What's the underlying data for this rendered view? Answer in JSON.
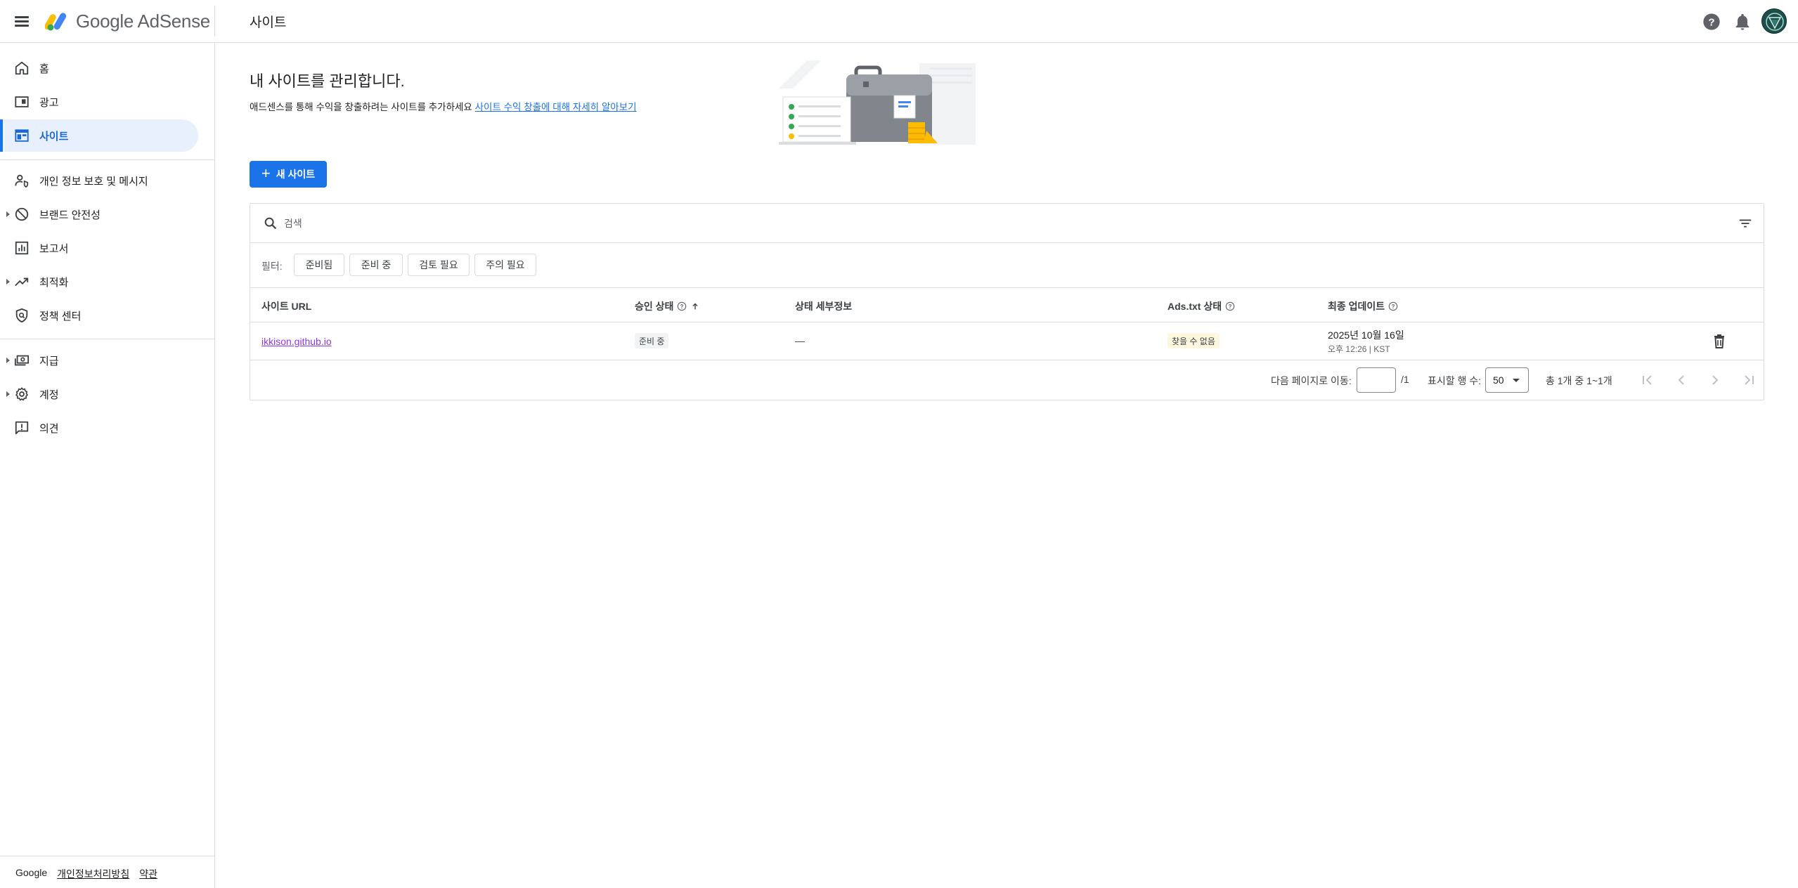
{
  "header": {
    "logo_text": "Google AdSense",
    "page_title": "사이트"
  },
  "sidebar": {
    "items": [
      {
        "label": "홈",
        "icon": "home-icon"
      },
      {
        "label": "광고",
        "icon": "ads-icon"
      },
      {
        "label": "사이트",
        "icon": "sites-icon",
        "active": true
      },
      {
        "label": "개인 정보 보호 및 메시지",
        "icon": "privacy-messaging-icon"
      },
      {
        "label": "브랜드 안전성",
        "icon": "block-icon",
        "expandable": true
      },
      {
        "label": "보고서",
        "icon": "reports-icon"
      },
      {
        "label": "최적화",
        "icon": "trending-up-icon",
        "expandable": true
      },
      {
        "label": "정책 센터",
        "icon": "policy-shield-icon"
      },
      {
        "label": "지급",
        "icon": "payments-icon",
        "expandable": true
      },
      {
        "label": "계정",
        "icon": "gear-icon",
        "expandable": true
      },
      {
        "label": "의견",
        "icon": "feedback-icon"
      }
    ],
    "footer": {
      "brand": "Google",
      "privacy": "개인정보처리방침",
      "terms": "약관"
    }
  },
  "main": {
    "heading": "내 사이트를 관리합니다.",
    "subtitle": "애드센스를 통해 수익을 창출하려는 사이트를 추가하세요",
    "learn_more": "사이트 수익 창출에 대해 자세히 알아보기",
    "new_site_button": "새 사이트",
    "search_placeholder": "검색",
    "filter_label": "필터:",
    "filters": [
      "준비됨",
      "준비 중",
      "검토 필요",
      "주의 필요"
    ],
    "table": {
      "columns": [
        "사이트 URL",
        "승인 상태",
        "상태 세부정보",
        "Ads.txt 상태",
        "최종 업데이트"
      ],
      "rows": [
        {
          "url": "ikkison.github.io",
          "approval_status": "준비 중",
          "status_detail": "—",
          "ads_txt_status": "찾을 수 없음",
          "updated_date": "2025년 10월 16일",
          "updated_time": "오후 12:26 | KST"
        }
      ]
    },
    "pagination": {
      "goto_label": "다음 페이지로 이동:",
      "total_pages": "/1",
      "rows_label": "표시할 행 수:",
      "rows_value": "50",
      "range_text": "총 1개 중 1~1개"
    }
  },
  "colors": {
    "accent": "#1a73e8",
    "active_bg": "#e8f0fe",
    "link_visited": "#9334e6",
    "warning_badge": "#fef7e0"
  }
}
